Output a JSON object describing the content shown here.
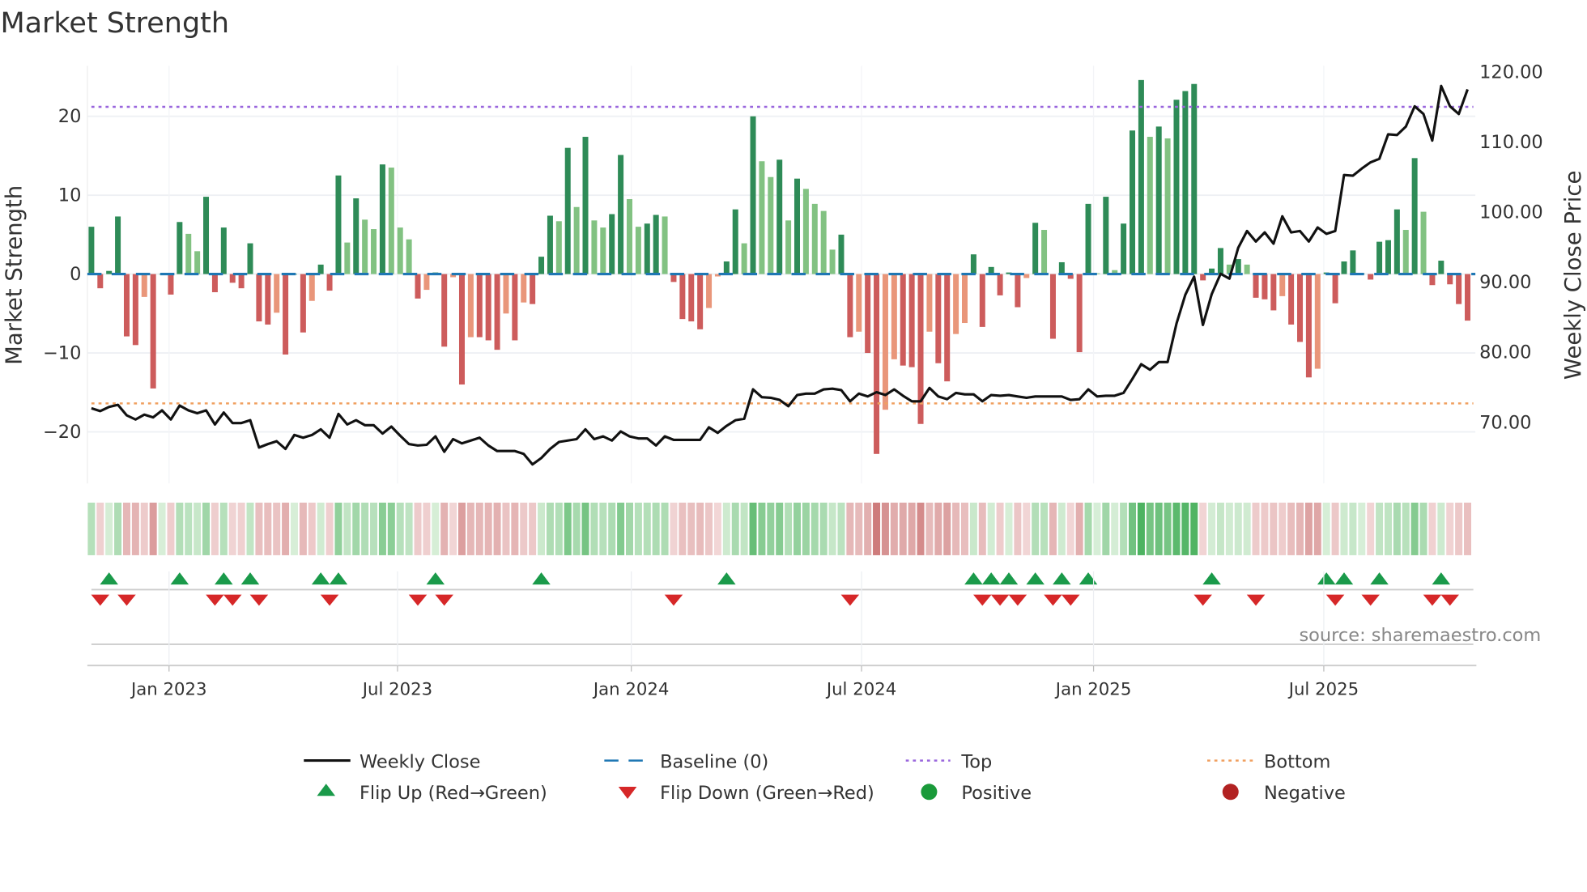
{
  "chart_data": {
    "type": "bar",
    "title": "Market Strength",
    "ylabel": "Market Strength",
    "y2label": "Weekly Close Price",
    "ylim": [
      -26,
      25
    ],
    "y2lim": [
      63.5,
      121
    ],
    "yticks": [
      "20",
      "10",
      "0",
      "−10",
      "−20"
    ],
    "ytick_values": [
      20,
      10,
      0,
      -10,
      -20
    ],
    "y2ticks": [
      "120.00",
      "110.00",
      "100.00",
      "90.00",
      "80.00",
      "70.00"
    ],
    "y2tick_values": [
      120,
      110,
      100,
      90,
      80,
      70
    ],
    "xticks": [
      {
        "label": "Jan 2023",
        "week": 8.8
      },
      {
        "label": "Jul 2023",
        "week": 34.7
      },
      {
        "label": "Jan 2024",
        "week": 61.2
      },
      {
        "label": "Jul 2024",
        "week": 87.3
      },
      {
        "label": "Jan 2025",
        "week": 113.6
      },
      {
        "label": "Jul 2025",
        "week": 139.7
      }
    ],
    "top_level": 21.2,
    "bottom_level": -16.4,
    "strength": [
      6.0,
      -1.8,
      0.4,
      7.3,
      -7.9,
      -9.0,
      -2.9,
      -14.5,
      0,
      -2.6,
      6.6,
      5.1,
      2.9,
      9.8,
      -2.3,
      5.9,
      -1.1,
      -1.8,
      3.9,
      -6.0,
      -6.4,
      -4.9,
      -10.2,
      0,
      -7.4,
      -3.4,
      1.2,
      -2.1,
      12.5,
      4.0,
      9.6,
      6.9,
      5.7,
      13.9,
      13.5,
      5.9,
      4.4,
      -3.1,
      -2.0,
      0.2,
      -9.2,
      -0.4,
      -14.0,
      -8.0,
      -8.0,
      -8.4,
      -9.6,
      -5.0,
      -8.4,
      -3.6,
      -3.8,
      2.2,
      7.4,
      6.7,
      16.0,
      8.5,
      17.4,
      6.8,
      5.9,
      7.6,
      15.1,
      9.5,
      6.0,
      6.4,
      7.5,
      7.3,
      -1.0,
      -5.7,
      -6.0,
      -7.0,
      -4.3,
      -0.3,
      1.6,
      8.2,
      3.9,
      20.0,
      14.3,
      12.3,
      14.5,
      6.8,
      12.1,
      10.8,
      8.9,
      8.0,
      3.1,
      5.0,
      -8.0,
      -7.3,
      -10.0,
      -22.8,
      -17.2,
      -10.8,
      -11.6,
      -11.8,
      -19.0,
      -7.3,
      -11.3,
      -13.6,
      -7.6,
      -6.2,
      2.5,
      -6.7,
      0.9,
      -2.7,
      0.2,
      -4.2,
      -0.5,
      6.5,
      5.6,
      -8.2,
      1.5,
      -0.6,
      -9.9,
      8.9,
      0.1,
      9.8,
      0.5,
      6.4,
      18.2,
      24.6,
      17.4,
      18.7,
      17.2,
      22.1,
      23.2,
      24.1,
      -0.8,
      0.7,
      3.3,
      1.2,
      1.9,
      1.2,
      -3.0,
      -3.2,
      -4.6,
      -2.8,
      -6.4,
      -8.6,
      -13.1,
      -12.0,
      0.2,
      -3.7,
      1.6,
      3.0,
      0.1,
      -0.7,
      4.1,
      4.3,
      8.2,
      5.6,
      14.7,
      7.9,
      -1.4,
      1.7,
      -1.3,
      -3.8,
      -5.9
    ],
    "weekly_close": [
      72.0,
      71.6,
      72.2,
      72.5,
      71.0,
      70.4,
      71.1,
      70.7,
      71.7,
      70.4,
      72.4,
      71.7,
      71.3,
      71.7,
      69.7,
      71.4,
      69.9,
      69.9,
      70.3,
      66.4,
      66.9,
      67.3,
      66.2,
      68.2,
      67.8,
      68.2,
      69.0,
      67.8,
      71.2,
      69.7,
      70.3,
      69.6,
      69.6,
      68.4,
      69.4,
      68.1,
      66.9,
      66.7,
      66.8,
      68.0,
      65.8,
      67.6,
      67.0,
      67.4,
      67.8,
      66.7,
      65.9,
      65.9,
      65.9,
      65.5,
      64.0,
      64.9,
      66.2,
      67.2,
      67.4,
      67.6,
      69.0,
      67.6,
      68.0,
      67.4,
      68.7,
      68.0,
      67.7,
      67.7,
      66.7,
      68.0,
      67.5,
      67.5,
      67.5,
      67.5,
      69.3,
      68.5,
      69.5,
      70.3,
      70.5,
      74.7,
      73.6,
      73.5,
      73.2,
      72.3,
      73.9,
      74.1,
      74.1,
      74.7,
      74.8,
      74.6,
      73.0,
      74.1,
      73.7,
      74.3,
      73.9,
      74.7,
      73.8,
      73.0,
      73.0,
      74.9,
      73.7,
      73.3,
      74.2,
      74.0,
      74.0,
      73.0,
      73.9,
      73.8,
      73.9,
      73.7,
      73.5,
      73.7,
      73.7,
      73.7,
      73.7,
      73.2,
      73.3,
      74.7,
      73.7,
      73.8,
      73.8,
      74.2,
      76.2,
      78.3,
      77.5,
      78.6,
      78.6,
      84.1,
      88.2,
      90.8,
      83.9,
      88.3,
      91.2,
      90.5,
      94.9,
      97.3,
      95.8,
      97.1,
      95.5,
      99.4,
      97.1,
      97.3,
      95.8,
      97.8,
      96.9,
      97.3,
      105.3,
      105.2,
      106.2,
      107.1,
      107.6,
      111.1,
      111.0,
      112.2,
      115.1,
      114.0,
      110.2,
      118.0,
      115.1,
      114.0,
      117.5
    ],
    "colors": {
      "pos_rising": "#2e8b57",
      "pos_falling": "#82c282",
      "neg_falling": "#cd5c5c",
      "neg_rising": "#e9967a",
      "close": "#111111",
      "baseline": "#1f77b4",
      "top": "#9966dd",
      "bottom": "#f0a060",
      "flip_up": "#1a9a4a",
      "flip_down": "#d62728",
      "positive": "#1a9a3a",
      "negative": "#b22222"
    },
    "legend": {
      "placement": "bottom",
      "weekly_close": "Weekly Close",
      "baseline": "Baseline (0)",
      "top": "Top",
      "bottom": "Bottom",
      "flip_up": "Flip Up (Red→Green)",
      "flip_down": "Flip Down (Green→Red)",
      "positive": "Positive",
      "negative": "Negative"
    },
    "source": "source: sharemaestro.com"
  }
}
